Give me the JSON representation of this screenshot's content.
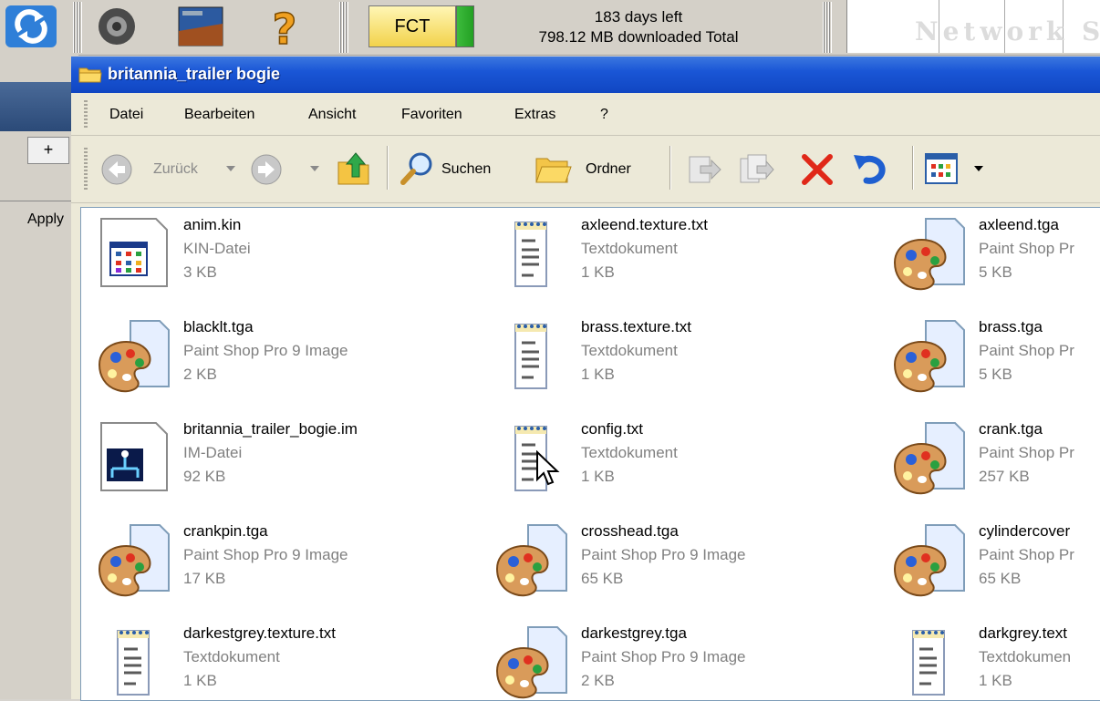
{
  "background_app": {
    "fct_label": "FCT",
    "status_line1": "183 days left",
    "status_line2": "798.12 MB downloaded Total",
    "network_text": "Network S",
    "plus_label": "+",
    "apply_label": "Apply"
  },
  "window": {
    "title": "britannia_trailer bogie"
  },
  "menu": [
    "Datei",
    "Bearbeiten",
    "Ansicht",
    "Favoriten",
    "Extras",
    "?"
  ],
  "toolbar": {
    "back_label": "Zurück",
    "search_label": "Suchen",
    "folders_label": "Ordner"
  },
  "files": [
    {
      "name": "anim.kin",
      "type": "KIN-Datei",
      "size": "3 KB",
      "icon": "kin-file-icon"
    },
    {
      "name": "axleend.texture.txt",
      "type": "Textdokument",
      "size": "1 KB",
      "icon": "text-file-icon"
    },
    {
      "name": "axleend.tga",
      "type": "Paint Shop Pr",
      "size": "5 KB",
      "icon": "paint-file-icon"
    },
    {
      "name": "blacklt.tga",
      "type": "Paint Shop Pro 9 Image",
      "size": "2 KB",
      "icon": "paint-file-icon"
    },
    {
      "name": "brass.texture.txt",
      "type": "Textdokument",
      "size": "1 KB",
      "icon": "text-file-icon"
    },
    {
      "name": "brass.tga",
      "type": "Paint Shop Pr",
      "size": "5 KB",
      "icon": "paint-file-icon"
    },
    {
      "name": "britannia_trailer_bogie.im",
      "type": "IM-Datei",
      "size": "92 KB",
      "icon": "im-file-icon"
    },
    {
      "name": "config.txt",
      "type": "Textdokument",
      "size": "1 KB",
      "icon": "text-file-icon"
    },
    {
      "name": "crank.tga",
      "type": "Paint Shop Pr",
      "size": "257 KB",
      "icon": "paint-file-icon"
    },
    {
      "name": "crankpin.tga",
      "type": "Paint Shop Pro 9 Image",
      "size": "17 KB",
      "icon": "paint-file-icon"
    },
    {
      "name": "crosshead.tga",
      "type": "Paint Shop Pro 9 Image",
      "size": "65 KB",
      "icon": "paint-file-icon"
    },
    {
      "name": "cylindercover",
      "type": "Paint Shop Pr",
      "size": "65 KB",
      "icon": "paint-file-icon"
    },
    {
      "name": "darkestgrey.texture.txt",
      "type": "Textdokument",
      "size": "1 KB",
      "icon": "text-file-icon"
    },
    {
      "name": "darkestgrey.tga",
      "type": "Paint Shop Pro 9 Image",
      "size": "2 KB",
      "icon": "paint-file-icon"
    },
    {
      "name": "darkgrey.text",
      "type": "Textdokumen",
      "size": "1 KB",
      "icon": "text-file-icon"
    }
  ],
  "colors": {
    "titlebar": "#1a56d6",
    "window_bg": "#ece9d8",
    "secondary_text": "#808080"
  }
}
